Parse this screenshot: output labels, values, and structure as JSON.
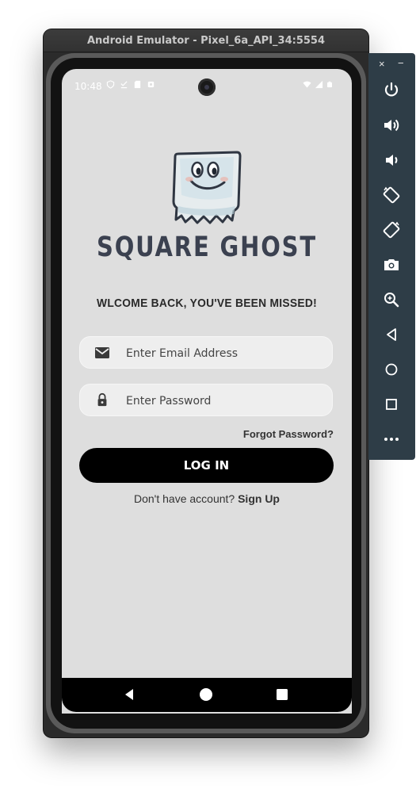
{
  "window": {
    "title": "Android Emulator - Pixel_6a_API_34:5554"
  },
  "status_bar": {
    "time": "10:48"
  },
  "app": {
    "brand": "SQUARE GHOST",
    "welcome": "WLCOME BACK, YOU'VE BEEN MISSED!",
    "email": {
      "placeholder": "Enter Email Address",
      "value": "",
      "icon": "email-icon"
    },
    "password": {
      "placeholder": "Enter Password",
      "value": "",
      "icon": "lock-icon"
    },
    "forgot_label": "Forgot Password?",
    "login_label": "LOG IN",
    "signup_prompt": "Don't have account?",
    "signup_link": "Sign Up"
  },
  "nav": {
    "buttons": [
      "back-icon",
      "home-icon",
      "recents-icon"
    ]
  },
  "toolbar": {
    "close": "×",
    "minimize": "−",
    "buttons": [
      "power-icon",
      "volume-up-icon",
      "volume-down-icon",
      "rotate-left-icon",
      "rotate-right-icon",
      "camera-icon",
      "zoom-icon",
      "back-icon",
      "home-icon",
      "overview-icon",
      "more-icon"
    ]
  },
  "colors": {
    "screen_bg": "#dedede",
    "brand_text": "#3b4150",
    "button_bg": "#000000",
    "toolbar_bg": "#2e3d47"
  }
}
